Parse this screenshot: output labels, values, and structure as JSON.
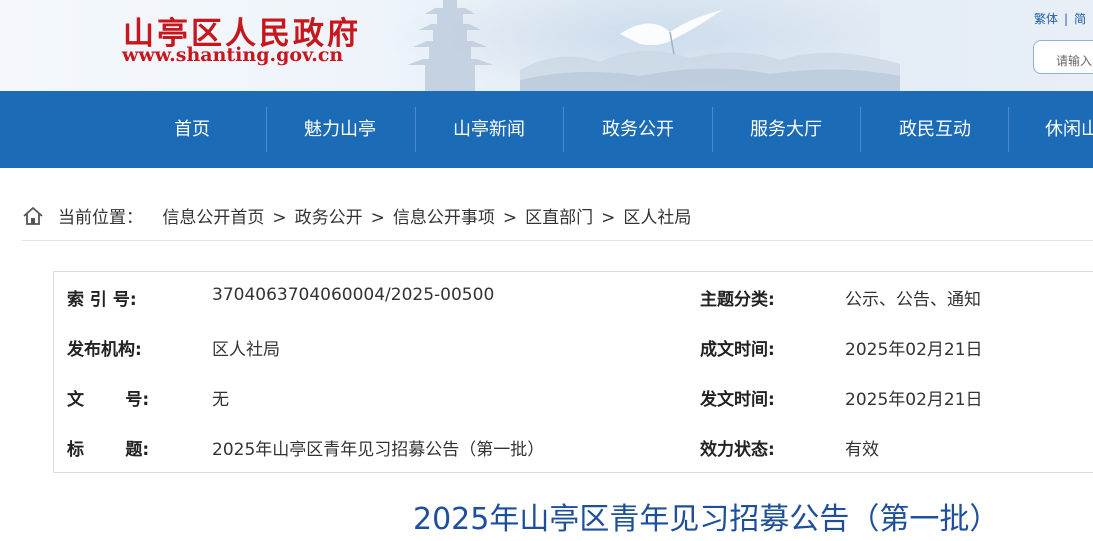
{
  "header": {
    "site_title": "山亭区人民政府",
    "site_url": "www.shanting.gov.cn",
    "lang_traditional": "繁体",
    "lang_partial": "简",
    "search_placeholder": "请输入"
  },
  "nav": {
    "items": [
      "首页",
      "魅力山亭",
      "山亭新闻",
      "政务公开",
      "服务大厅",
      "政民互动",
      "休闲山亭"
    ]
  },
  "breadcrumb": {
    "label": "当前位置：",
    "items": [
      "信息公开首页",
      "政务公开",
      "信息公开事项",
      "区直部门",
      "区人社局"
    ],
    "separator": ">"
  },
  "info": {
    "index_label": "索 引 号:",
    "index_value": "3704063704060004/2025-00500",
    "topic_label": "主题分类:",
    "topic_value": "公示、公告、通知",
    "publisher_label": "发布机构:",
    "publisher_value": "区人社局",
    "created_label": "成文时间:",
    "created_value": "2025年02月21日",
    "docno_label": "文       号:",
    "docno_value": "无",
    "issued_label": "发文时间:",
    "issued_value": "2025年02月21日",
    "title_label": "标       题:",
    "title_value": "2025年山亭区青年见习招募公告（第一批）",
    "status_label": "效力状态:",
    "status_value": "有效"
  },
  "article": {
    "title": "2025年山亭区青年见习招募公告（第一批）"
  },
  "colors": {
    "brand_red": "#c8161d",
    "nav_blue": "#1b6bb7",
    "title_blue": "#1e4f9c"
  }
}
